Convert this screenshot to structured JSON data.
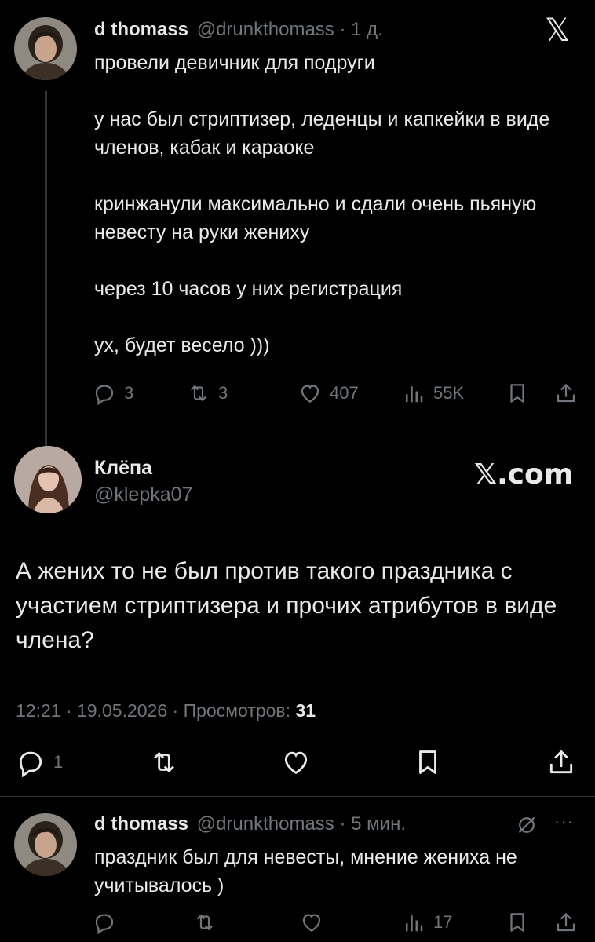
{
  "tweet1": {
    "author": "d thomass",
    "handle": "@drunkthomass",
    "sep": "·",
    "time": "1 д.",
    "text": "провели девичник для подруги\n\nу нас был стриптизер, леденцы и капкейки в виде членов, кабак и караоке\n\nкринжанули максимально и сдали очень пьяную невесту на руки жениху\n\nчерез 10 часов у них регистрация\n\nух, будет весело )))",
    "replies": "3",
    "reposts": "3",
    "likes": "407",
    "views": "55K"
  },
  "brand": {
    "x_logo": "𝕏",
    "x_com": "𝕏.com"
  },
  "tweet2": {
    "author": "Клёпа",
    "handle": "@klepka07",
    "text": "А жених то не был против такого праздника с участием стриптизера и прочих атрибутов в виде члена?",
    "time": "12:21",
    "date": "19.05.2026",
    "views_label": "Просмотров:",
    "views_count": "31",
    "replies": "1"
  },
  "tweet3": {
    "author": "d thomass",
    "handle": "@drunkthomass",
    "sep": "·",
    "time": "5 мин.",
    "more": "···",
    "text": "праздник был для невесты, мнение жениха не учитывалось )",
    "views": "17"
  },
  "colors": {
    "background": "#000000",
    "text": "#e7e9ea",
    "muted": "#71767b",
    "divider": "#2f3336"
  },
  "icons": [
    "reply-icon",
    "repost-icon",
    "like-icon",
    "views-icon",
    "bookmark-icon",
    "share-icon",
    "grok-icon"
  ]
}
